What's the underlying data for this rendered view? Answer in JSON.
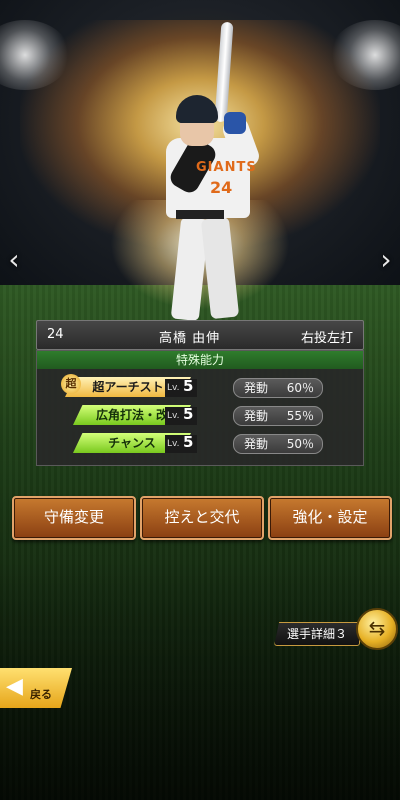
{
  "player": {
    "number": "24",
    "name": "高橋 由伸",
    "handedness": "右投左打",
    "jersey_team_text": "GIANTS",
    "jersey_number": "24"
  },
  "abilities": {
    "header": "特殊能力",
    "items": [
      {
        "badge": "超",
        "name": "超アーチスト",
        "lv_label": "Lv.",
        "level": "5",
        "effect_label": "発動",
        "effect_value": "60％",
        "style": "gold"
      },
      {
        "badge": "",
        "name": "広角打法・改",
        "lv_label": "Lv.",
        "level": "5",
        "effect_label": "発動",
        "effect_value": "55％",
        "style": "green"
      },
      {
        "badge": "",
        "name": "チャンス",
        "lv_label": "Lv.",
        "level": "5",
        "effect_label": "発動",
        "effect_value": "50％",
        "style": "green"
      }
    ]
  },
  "actions": {
    "defense_change": "守備変更",
    "bench_swap": "控えと交代",
    "enhance_settings": "強化・設定"
  },
  "detail": {
    "label": "選手詳細３"
  },
  "back": {
    "label": "戻る"
  },
  "nav": {
    "prev": "‹",
    "next": "›"
  },
  "icons": {
    "prev": "chevron-left-icon",
    "next": "chevron-right-icon",
    "swap": "swap-arrows-icon",
    "back": "back-arrow-icon"
  },
  "colors": {
    "ability_header": "#2f7d2c",
    "action_button": "#a85a20",
    "back_button": "#f0b830"
  }
}
